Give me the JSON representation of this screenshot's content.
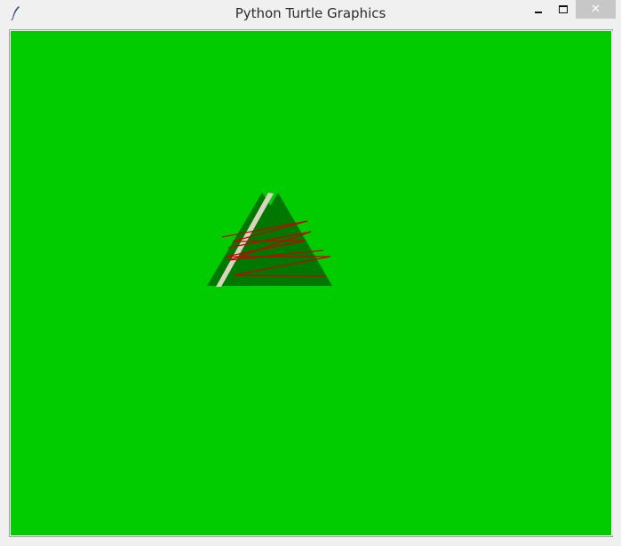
{
  "window": {
    "title": "Python Turtle Graphics",
    "icon": "feather-icon",
    "controls": {
      "minimize_icon": "minimize-icon",
      "maximize_icon": "maximize-icon",
      "close_label": "✕"
    }
  },
  "canvas": {
    "background_color": "#00cc00",
    "drawing": {
      "tree_color": "#007700",
      "stripe_color": "#d8d4c0",
      "line_color": "#cc0000"
    }
  }
}
